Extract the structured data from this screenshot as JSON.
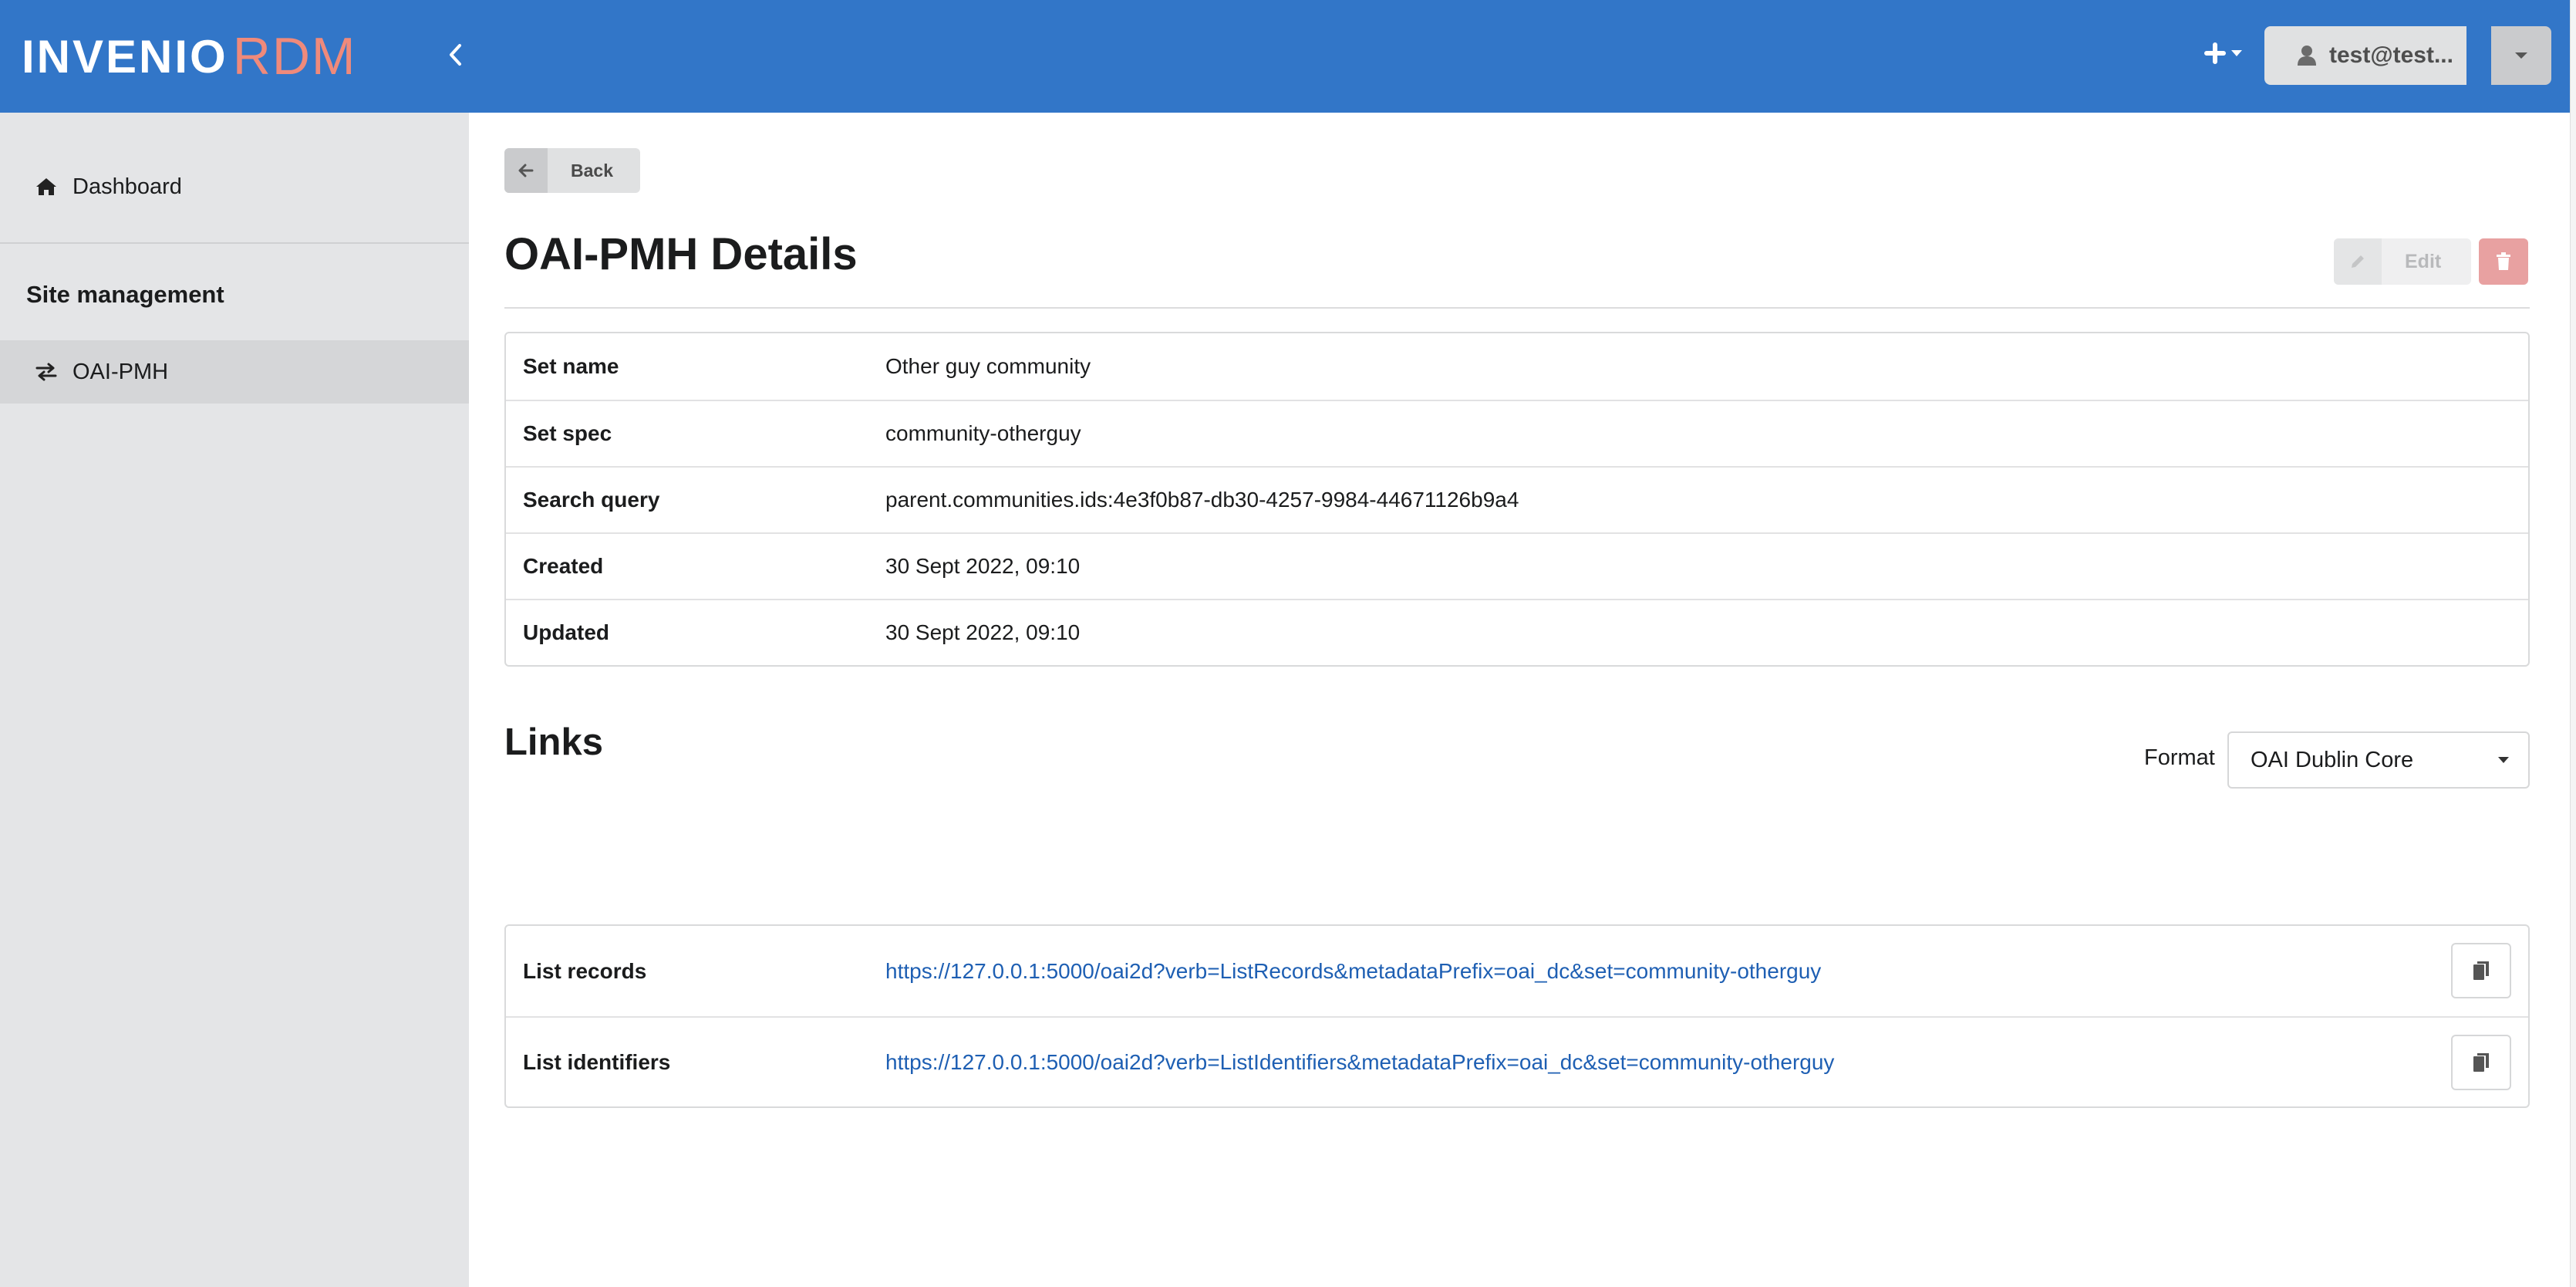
{
  "header": {
    "logo_primary": "INVENIO",
    "logo_accent": "RDM",
    "user_label": "test@test...",
    "brand_color": "#3276c8",
    "accent_color": "#ef8a7b",
    "icons": {
      "collapse": "chevron-left-icon",
      "new": "plus-icon",
      "user": "user-icon",
      "caret": "caret-down-icon"
    }
  },
  "sidebar": {
    "dashboard_label": "Dashboard",
    "section_heading": "Site management",
    "items": [
      {
        "label": "OAI-PMH",
        "icon": "exchange-icon",
        "active": true
      }
    ]
  },
  "main": {
    "back_label": "Back",
    "title": "OAI-PMH Details",
    "edit_label": "Edit",
    "details": [
      {
        "key": "Set name",
        "value": "Other guy community"
      },
      {
        "key": "Set spec",
        "value": "community-otherguy"
      },
      {
        "key": "Search query",
        "value": "parent.communities.ids:4e3f0b87-db30-4257-9984-44671126b9a4"
      },
      {
        "key": "Created",
        "value": "30 Sept 2022, 09:10"
      },
      {
        "key": "Updated",
        "value": "30 Sept 2022, 09:10"
      }
    ],
    "links_title": "Links",
    "format_label": "Format",
    "format_value": "OAI Dublin Core",
    "links": [
      {
        "key": "List records",
        "value": "https://127.0.0.1:5000/oai2d?verb=ListRecords&metadataPrefix=oai_dc&set=community-otherguy"
      },
      {
        "key": "List identifiers",
        "value": "https://127.0.0.1:5000/oai2d?verb=ListIdentifiers&metadataPrefix=oai_dc&set=community-otherguy"
      }
    ],
    "link_color": "#1e5fb3",
    "delete_color": "#e8a1a1"
  }
}
